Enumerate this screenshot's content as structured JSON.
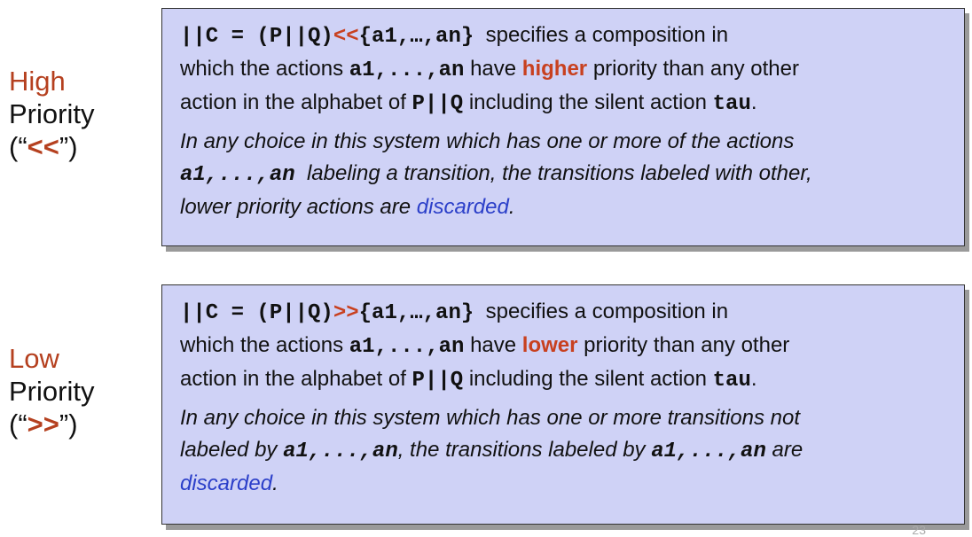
{
  "high": {
    "label_word": "High",
    "label_priority": "Priority",
    "label_open": "(“",
    "label_op": "<<",
    "label_close": "”)",
    "def_code_prefix": "||C = (P||Q)",
    "def_op": "<<",
    "def_code_suffix": "{a1,…,an}",
    "def_text1": "specifies a composition in",
    "def_text2": "which the actions",
    "def_code2": "a1,...,an",
    "def_text3": "have",
    "def_highlight": "higher",
    "def_text4": "priority than any other",
    "def_text5": "action in the alphabet of",
    "def_code3": "P||Q",
    "def_text6": "including the silent action",
    "def_code4": "tau",
    "def_end": ".",
    "note_line1": "In any choice in this system which has one or more of the actions",
    "note_code1": "a1,...,an",
    "note_line2": "labeling a transition, the transitions labeled with other,",
    "note_line3": "lower priority actions are",
    "note_blue": "discarded",
    "note_end": "."
  },
  "low": {
    "label_word": "Low",
    "label_priority": "Priority",
    "label_open": "(“",
    "label_op": ">>",
    "label_close": "”)",
    "def_code_prefix": "||C = (P||Q)",
    "def_op": ">>",
    "def_code_suffix": "{a1,…,an}",
    "def_text1": "specifies a composition in",
    "def_text2": "which the actions",
    "def_code2": "a1,...,an",
    "def_text3": "have",
    "def_highlight": "lower",
    "def_text4": "priority than any other",
    "def_text5": "action in the alphabet of",
    "def_code3": "P||Q",
    "def_text6": "including the silent action",
    "def_code4": "tau",
    "def_end": ".",
    "note_line1": "In any choice in this system which has one or more transitions not",
    "note_line2a": "labeled by",
    "note_code1": "a1,...,an",
    "note_line2b": ", the transitions labeled by",
    "note_code2": "a1,...,an",
    "note_line2c": "are",
    "note_blue": "discarded",
    "note_end": "."
  },
  "page_number": "23",
  "colors": {
    "box_bg": "#cfd2f6",
    "accent": "#c8401f",
    "link_blue": "#2b3fc9"
  }
}
